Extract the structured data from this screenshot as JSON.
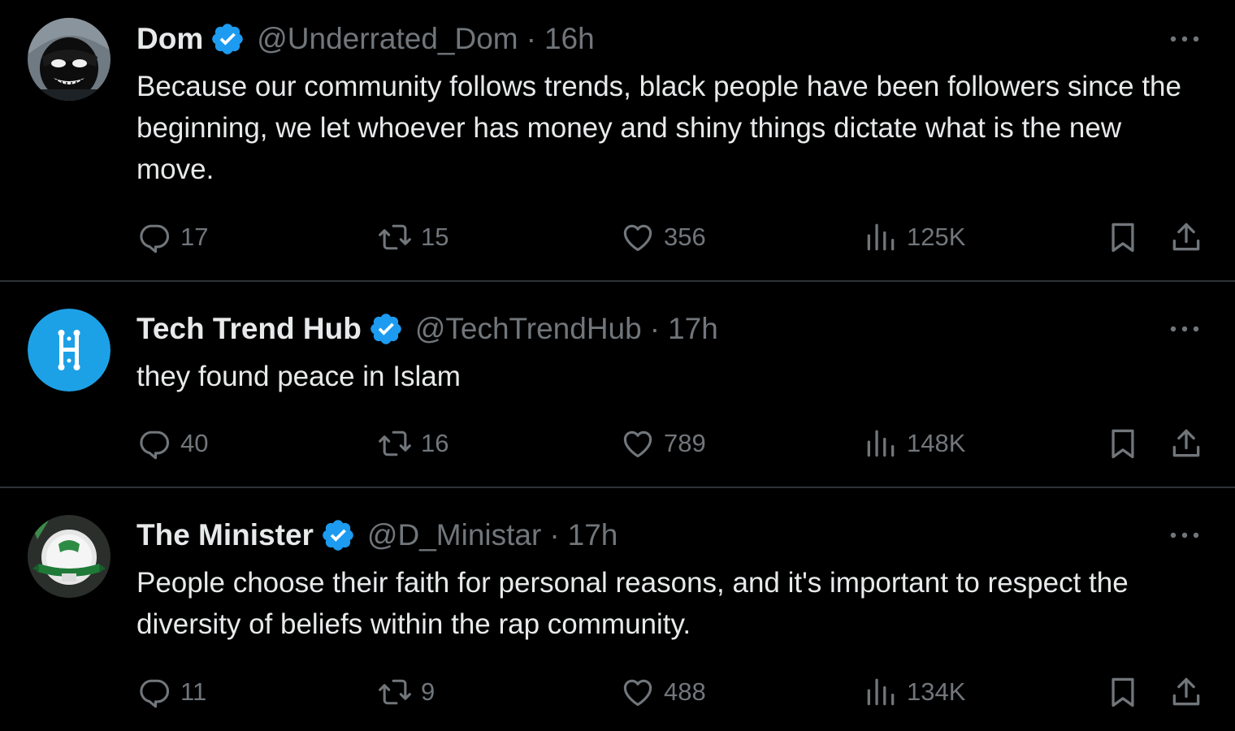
{
  "colors": {
    "background": "#000000",
    "divider": "#2f3336",
    "text_primary": "#e7e9ea",
    "text_secondary": "#71767b",
    "verified_blue": "#1d9bf0"
  },
  "tweets": [
    {
      "name": "Dom",
      "handle": "@Underrated_Dom",
      "separator": "·",
      "time": "16h",
      "verified": true,
      "verified_icon": "verified-badge-icon",
      "avatar": "avatar-masked-character",
      "text": "Because our community follows trends, black people have been followers since the beginning, we let whoever has money and shiny things dictate what is the new move.",
      "replies": "17",
      "reposts": "15",
      "likes": "356",
      "views": "125K"
    },
    {
      "name": "Tech Trend Hub",
      "handle": "@TechTrendHub",
      "separator": "·",
      "time": "17h",
      "verified": true,
      "verified_icon": "verified-badge-icon",
      "avatar": "avatar-tech-logo",
      "text": "they found peace in Islam",
      "replies": "40",
      "reposts": "16",
      "likes": "789",
      "views": "148K"
    },
    {
      "name": "The Minister",
      "handle": "@D_Ministar",
      "separator": "·",
      "time": "17h",
      "verified": true,
      "verified_icon": "verified-badge-icon",
      "avatar": "avatar-independence-badge",
      "text": "People choose their faith for personal reasons, and it's important to respect the diversity of beliefs within the rap community.",
      "replies": "11",
      "reposts": "9",
      "likes": "488",
      "views": "134K"
    }
  ],
  "icons": {
    "more": "more-horizontal-icon",
    "reply": "reply-icon",
    "repost": "repost-icon",
    "like": "heart-icon",
    "views": "views-chart-icon",
    "bookmark": "bookmark-icon",
    "share": "share-icon"
  }
}
